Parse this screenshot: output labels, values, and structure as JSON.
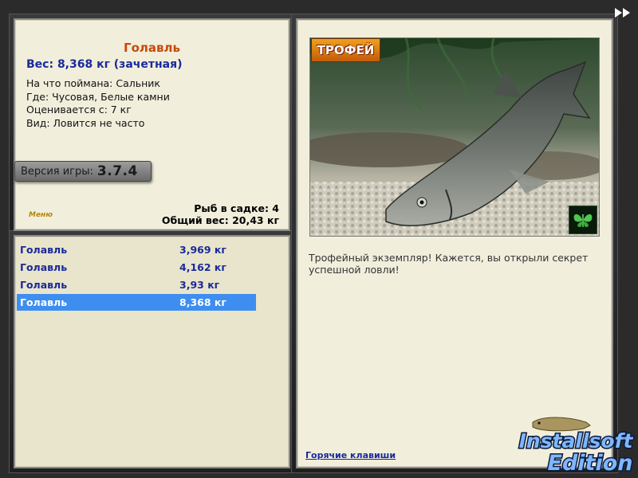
{
  "fish": {
    "name": "Голавль",
    "weight_line": "Вес: 8,368 кг (зачетная)",
    "bait": "На что поймана: Сальник",
    "location": "Где: Чусовая, Белые камни",
    "rated_from": "Оценивается с: 7 кг",
    "rarity": "Вид: Ловится не часто"
  },
  "version": {
    "label": "Версия игры:",
    "number": "3.7.4"
  },
  "menu_label": "Меню",
  "stats": {
    "count": "Рыб в садке: 4",
    "total": "Общий вес: 20,43 кг"
  },
  "catch_list": [
    {
      "name": "Голавль",
      "weight": "3,969 кг"
    },
    {
      "name": "Голавль",
      "weight": "4,162 кг"
    },
    {
      "name": "Голавль",
      "weight": "3,93 кг"
    },
    {
      "name": "Голавль",
      "weight": "8,368 кг"
    }
  ],
  "trophy_label": "ТРОФЕЙ",
  "description": "Трофейный экземпляр! Кажется, вы открыли секрет успешной ловли!",
  "hotkeys_label": "Горячие клавиши",
  "brand": {
    "line1": "Installsoft",
    "line2": "Edition"
  },
  "colors": {
    "fish_name": "#c84a0a",
    "weight": "#1a2a9a",
    "selected_row": "#3d8ef0"
  }
}
